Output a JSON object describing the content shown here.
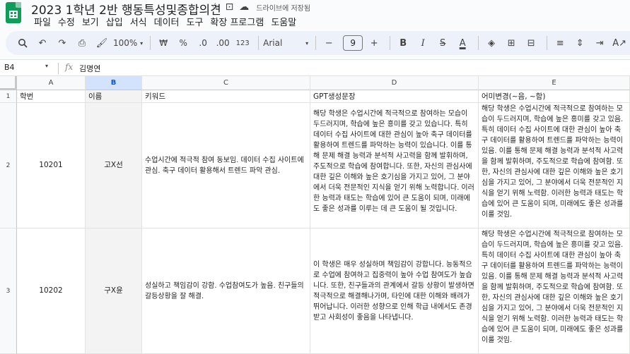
{
  "app": {
    "doc_title": "2023 1학년 2반 행동특성및종합의견",
    "save_status": "드라이브에 저장됨",
    "icons": [
      "star-icon",
      "move-to-folder-icon",
      "cloud-saved-icon"
    ]
  },
  "menu": [
    "파일",
    "수정",
    "보기",
    "삽입",
    "서식",
    "데이터",
    "도구",
    "확장 프로그램",
    "도움말"
  ],
  "toolbar": {
    "zoom": "100%",
    "currency": "₩",
    "percent": "%",
    "decrease_decimal": ".0",
    "increase_decimal": ".00",
    "number_format": "123",
    "font": "Arial",
    "font_size": "9",
    "bold": "B",
    "italic": "I",
    "strike": "S",
    "text_color": "A"
  },
  "formula_bar": {
    "cell_ref": "B4",
    "fx": "fx",
    "value": "김명연"
  },
  "columns": [
    "A",
    "B",
    "C",
    "D",
    "E"
  ],
  "rows": [
    {
      "num": "1",
      "cells": [
        "학번",
        "이름",
        "키워드",
        "GPT생성문장",
        "어미변경(~음, ~함)"
      ]
    },
    {
      "num": "2",
      "cells": [
        "10201",
        "고X선",
        "수업시간에 적극적 참여 동보임. 데이터 수집 사이트에 관심. 축구 데이터 활용해서 트렌드 파악 관심.",
        "해당 학생은 수업시간에 적극적으로 참여하는 모습이 두드러지며, 학습에 높은 흥미를 갖고 있습니다. 특히 데이터 수집 사이트에 대한 관심이 높아 축구 데이터를 활용하여 트렌드를 파악하는 능력이 있습니다. 이를 통해 문제 해결 능력과 분석적 사고력을 함께 발휘하며, 주도적으로 학습에 참여합니다. 또한, 자신의 관심사에 대한 깊은 이해와 높은 호기심을 가지고 있어, 그 분야에서 더욱 전문적인 지식을 얻기 위해 노력합니다. 이러한 능력과 태도는 학습에 있어 큰 도움이 되며, 미래에도 좋은 성과를 이루는 데 큰 도움이 될 것입니다.",
        "해당 학생은 수업시간에 적극적으로 참여하는 모습이 두드러지며, 학습에 높은 흥미를 갖고 있음. 특히 데이터 수집 사이트에 대한 관심이 높아 축구 데이터를 활용하여 트렌드를 파악하는 능력이 있음. 이를 통해 문제 해결 능력과 분석적 사고력을 함께 발휘하며, 주도적으로 학습에 참여함. 또한, 자신의 관심사에 대한 깊은 이해와 높은 호기심을 가지고 있어, 그 분야에서 더욱 전문적인 지식을 얻기 위해 노력함. 이러한 능력과 태도는 학습에 있어 큰 도움이 되며, 미래에도 좋은 성과를 이룰 것임."
      ]
    },
    {
      "num": "3",
      "cells": [
        "10202",
        "구X윤",
        "성실하고 책임감이 강함. 수업참여도가 높음. 친구들의 갈등상황을 잘 해결.",
        "이 학생은 매우 성실하며 책임감이 강합니다. 능동적으로 수업에 참여하고 집중력이 높아 수업 참여도가 높습니다. 또한, 친구들과의 관계에서 갈등 상황이 발생하면 적극적으로 해결해나가며, 타인에 대한 이해와 배려가 뛰어납니다. 이러한 성향으로 인해 학급 내에서도 존경받고 사회성이 좋음을 나타냅니다.",
        "해당 학생은 수업시간에 적극적으로 참여하는 모습이 두드러지며, 학습에 높은 흥미를 갖고 있음. 특히 데이터 수집 사이트에 대한 관심이 높아 축구 데이터를 활용하여 트렌드를 파악하는 능력이 있음. 이를 통해 문제 해결 능력과 분석적 사고력을 함께 발휘하며, 주도적으로 학습에 참여함. 또한, 자신의 관심사에 대한 깊은 이해와 높은 호기심을 가지고 있어, 그 분야에서 더욱 전문적인 지식을 얻기 위해 노력함. 이러한 능력과 태도는 학습에 있어 큰 도움이 되며, 미래에도 좋은 성과를 이룰 것임."
      ]
    }
  ]
}
